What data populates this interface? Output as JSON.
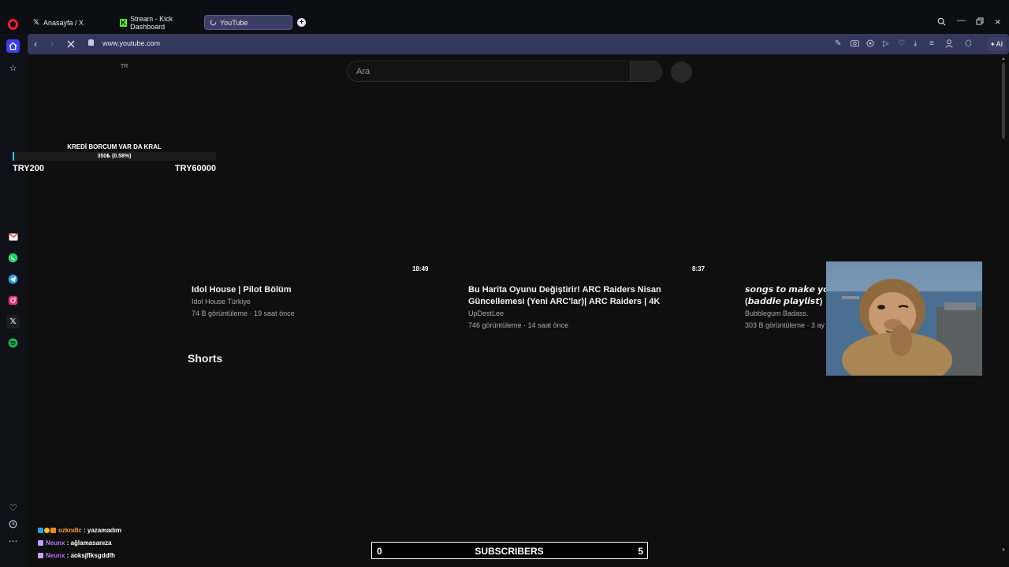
{
  "browser": {
    "tabs": [
      {
        "label": "Anasayfa / X",
        "icon": "x-logo-icon"
      },
      {
        "label": "Stream - Kick Dashboard",
        "icon": "kick-logo-icon"
      },
      {
        "label": "YouTube",
        "icon": "loading-spinner-icon",
        "active": true
      }
    ],
    "url": "www.youtube.com",
    "ai_label": "AI"
  },
  "youtube": {
    "search_placeholder": "Ara",
    "country_code": "TR",
    "videos": [
      {
        "duration": "18:49",
        "title": "Idol House | Pilot Bölüm",
        "channel": "Idol House Türkiye",
        "meta": "74 B görüntüleme · 19 saat önce"
      },
      {
        "duration": "8:37",
        "title": "Bu Harita Oyunu Değiştirir! ARC Raiders Nisan Güncellemesi (Yeni ARC'lar)| ARC Raiders | 4K",
        "channel": "UpDestLee",
        "meta": "746 görüntüleme · 14 saat önce"
      },
      {
        "duration": "",
        "title": "𝙨𝙤𝙣𝙜𝙨 𝙩𝙤 𝙢𝙖𝙠𝙚 𝙮𝙤𝙪 𝙛𝙚𝙚𝙡 (𝙗𝙖𝙙𝙙𝙞𝙚 𝙥𝙡𝙖𝙮𝙡𝙞𝙨𝙩)",
        "channel": "Bubblegum Badass.",
        "meta": "303 B görüntüleme · 3 ay önce"
      }
    ],
    "shorts_title": "Shorts"
  },
  "overlay": {
    "goal": {
      "title": "KREDİ BORCUM VAR DA KRAL",
      "progress_text": "350₺ (0.58%)",
      "progress_fraction": 0.0058,
      "min_label": "TRY200",
      "max_label": "TRY60000",
      "fill_color": "#00d8ff"
    },
    "chat": [
      {
        "user": "ozkndlc",
        "user_color": "#ff9f3a",
        "message": "yazamadım",
        "badges": [
          "#2f9ee8",
          "#f0c020",
          "#f08a20"
        ]
      },
      {
        "user": "Neunx",
        "user_color": "#b277f0",
        "message": "ağlamasanıza",
        "badges": [
          "#c7a0ff"
        ]
      },
      {
        "user": "Neunx",
        "user_color": "#b277f0",
        "message": "aoksjflksgddfh",
        "badges": [
          "#c7a0ff"
        ]
      }
    ],
    "subscribers": {
      "current": "0",
      "label": "SUBSCRIBERS",
      "goal": "5"
    }
  },
  "colors": {
    "accent": "#3d3ff1",
    "opera_red": "#ff1b2d",
    "address_bar": "#33385d"
  }
}
